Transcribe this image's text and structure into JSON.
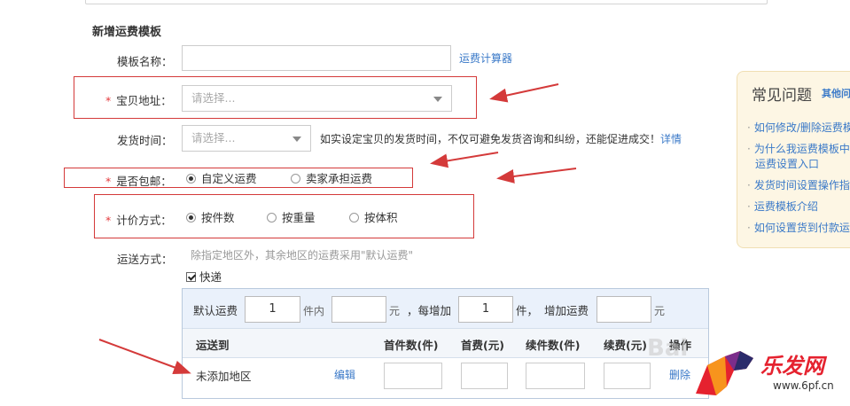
{
  "form": {
    "section_title": "新增运费模板",
    "template_name_label": "模板名称：",
    "template_name_value": "",
    "calculator_link": "运费计算器",
    "required_mark": "*",
    "address_label": "宝贝地址：",
    "address_placeholder": "请选择...",
    "ship_time_label": "发货时间：",
    "ship_time_placeholder": "请选择...",
    "ship_time_hint": "如实设定宝贝的发货时间，不仅可避免发货咨询和纠纷，还能促进成交！",
    "details_link": "详情",
    "free_ship_label": "是否包邮：",
    "free_ship_options": [
      "自定义运费",
      "卖家承担运费"
    ],
    "free_ship_selected": 0,
    "pricing_label": "计价方式：",
    "pricing_options": [
      "按件数",
      "按重量",
      "按体积"
    ],
    "pricing_selected": 0,
    "delivery_label": "运送方式：",
    "delivery_hint": "除指定地区外，其余地区的运费采用\"默认运费\"",
    "express_label": "快递",
    "express_checked": true
  },
  "express_panel": {
    "default_fee_label": "默认运费",
    "first_qty": "1",
    "unit_within": "件内",
    "first_fee": "",
    "yuan": "元",
    "each_add_label": "，每增加",
    "add_qty": "1",
    "unit_jian": "件，",
    "add_fee_label": "增加运费",
    "add_fee": "",
    "yuan2": "元",
    "headers": [
      "运送到",
      "首件数(件)",
      "首费(元)",
      "续件数(件)",
      "续费(元)",
      "操作"
    ],
    "row": {
      "region": "未添加地区",
      "edit": "编辑",
      "delete": "删除"
    }
  },
  "aside": {
    "title": "常见问题",
    "more": "其他问",
    "items": [
      "如何修改/删除运费模板",
      "为什么我运费模板中",
      "运费设置入口",
      "发货时间设置操作指",
      "运费模板介绍",
      "如何设置货到付款运"
    ]
  },
  "watermark": {
    "text": "Bai",
    "brand": "乐发网",
    "url": "www.6pf.cn"
  },
  "colors": {
    "link": "#3a79c8",
    "annotation_red": "#d43a3a",
    "panel_bg": "#eaf1fb",
    "aside_bg": "#fdf6e4"
  }
}
